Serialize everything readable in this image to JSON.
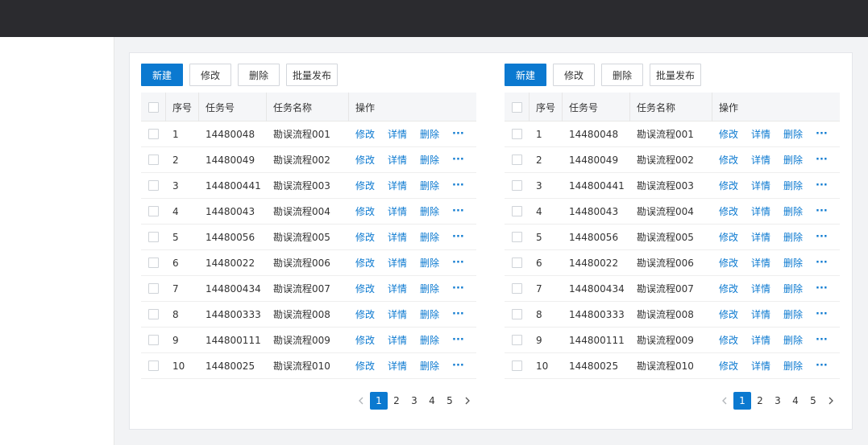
{
  "toolbar": {
    "new_label": "新建",
    "edit_label": "修改",
    "delete_label": "删除",
    "publish_label": "批量发布"
  },
  "table": {
    "headers": {
      "index": "序号",
      "task_id": "任务号",
      "task_name": "任务名称",
      "actions": "操作"
    },
    "action_labels": {
      "edit": "修改",
      "detail": "详情",
      "delete": "删除",
      "more": "···"
    },
    "rows": [
      {
        "index": "1",
        "task_id": "14480048",
        "task_name": "勘误流程001"
      },
      {
        "index": "2",
        "task_id": "14480049",
        "task_name": "勘误流程002"
      },
      {
        "index": "3",
        "task_id": "144800441",
        "task_name": "勘误流程003"
      },
      {
        "index": "4",
        "task_id": "14480043",
        "task_name": "勘误流程004"
      },
      {
        "index": "5",
        "task_id": "14480056",
        "task_name": "勘误流程005"
      },
      {
        "index": "6",
        "task_id": "14480022",
        "task_name": "勘误流程006"
      },
      {
        "index": "7",
        "task_id": "144800434",
        "task_name": "勘误流程007"
      },
      {
        "index": "8",
        "task_id": "144800333",
        "task_name": "勘误流程008"
      },
      {
        "index": "9",
        "task_id": "144800111",
        "task_name": "勘误流程009"
      },
      {
        "index": "10",
        "task_id": "14480025",
        "task_name": "勘误流程010"
      }
    ]
  },
  "pagination": {
    "prev_icon": "chevron-left-icon",
    "next_icon": "chevron-right-icon",
    "pages": [
      "1",
      "2",
      "3",
      "4",
      "5"
    ],
    "current": "1"
  },
  "colors": {
    "primary": "#0b79d0",
    "topbar": "#2b2b2f",
    "background": "#f2f3f5"
  }
}
